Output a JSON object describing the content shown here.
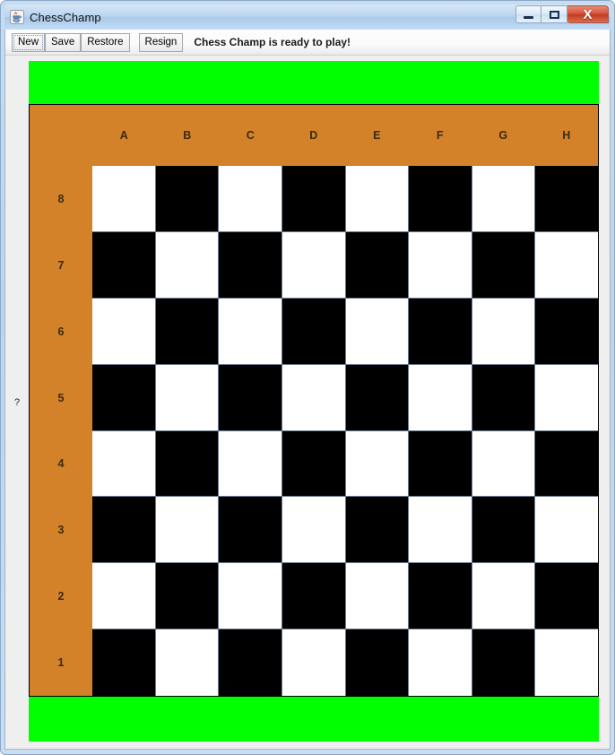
{
  "window": {
    "title": "ChessChamp",
    "icon": "java-coffee-cup-icon",
    "controls": {
      "minimize": "minimize-icon",
      "maximize": "maximize-icon",
      "close": "X"
    }
  },
  "toolbar": {
    "buttons": [
      {
        "label": "New",
        "focused": true
      },
      {
        "label": "Save",
        "focused": false
      },
      {
        "label": "Restore",
        "focused": false
      },
      {
        "label": "Resign",
        "focused": false,
        "gap": true
      }
    ],
    "status": "Chess Champ is ready to play!"
  },
  "content": {
    "side_marker": "?",
    "panels": {
      "top_color": "#00ff00",
      "bottom_color": "#00ff00"
    }
  },
  "board": {
    "background": "#d3822a",
    "grid_line_color": "#6b7a8f",
    "light_square": "#ffffff",
    "dark_square": "#000000",
    "files": [
      "A",
      "B",
      "C",
      "D",
      "E",
      "F",
      "G",
      "H"
    ],
    "ranks": [
      "8",
      "7",
      "6",
      "5",
      "4",
      "3",
      "2",
      "1"
    ],
    "squares": [
      [
        "light",
        "dark",
        "light",
        "dark",
        "light",
        "dark",
        "light",
        "dark"
      ],
      [
        "dark",
        "light",
        "dark",
        "light",
        "dark",
        "light",
        "dark",
        "light"
      ],
      [
        "light",
        "dark",
        "light",
        "dark",
        "light",
        "dark",
        "light",
        "dark"
      ],
      [
        "dark",
        "light",
        "dark",
        "light",
        "dark",
        "light",
        "dark",
        "light"
      ],
      [
        "light",
        "dark",
        "light",
        "dark",
        "light",
        "dark",
        "light",
        "dark"
      ],
      [
        "dark",
        "light",
        "dark",
        "light",
        "dark",
        "light",
        "dark",
        "light"
      ],
      [
        "light",
        "dark",
        "light",
        "dark",
        "light",
        "dark",
        "light",
        "dark"
      ],
      [
        "dark",
        "light",
        "dark",
        "light",
        "dark",
        "light",
        "dark",
        "light"
      ]
    ],
    "pieces": []
  }
}
